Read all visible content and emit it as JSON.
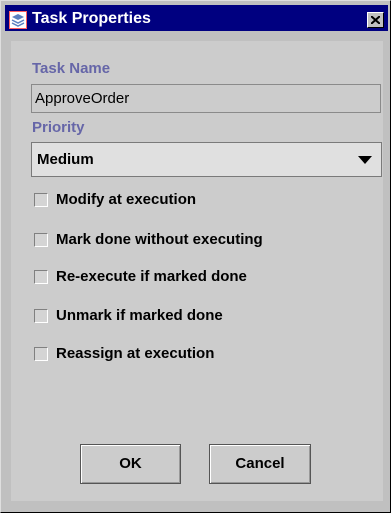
{
  "window": {
    "title": "Task Properties"
  },
  "task_name": {
    "label": "Task Name",
    "value": "ApproveOrder"
  },
  "priority": {
    "label": "Priority",
    "selected": "Medium"
  },
  "options": [
    {
      "label": "Modify at execution",
      "checked": false
    },
    {
      "label": "Mark done without executing",
      "checked": false
    },
    {
      "label": "Re-execute if marked done",
      "checked": false
    },
    {
      "label": "Unmark if marked done",
      "checked": false
    },
    {
      "label": "Reassign at execution",
      "checked": false
    }
  ],
  "buttons": {
    "ok": "OK",
    "cancel": "Cancel"
  },
  "colors": {
    "titlebar": "#000080",
    "label_accent": "#6666a8",
    "panel": "#cccccc"
  },
  "icons": {
    "title": "app-icon",
    "close": "close-icon",
    "dropdown": "chevron-down-icon"
  }
}
